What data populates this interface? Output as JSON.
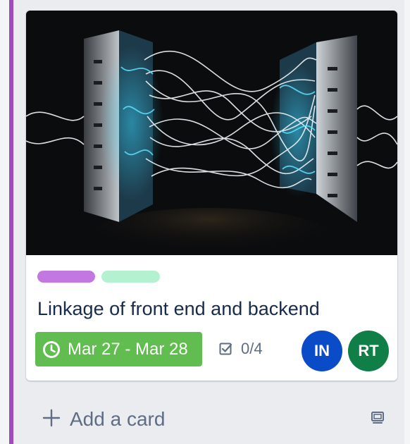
{
  "list": {
    "accent_color": "#a34ab9"
  },
  "card": {
    "cover": {
      "description_icon": "light-trails-cover-image"
    },
    "labels": [
      {
        "color": "#c377e0"
      },
      {
        "color": "#b3f1d0"
      }
    ],
    "title": "Linkage of front end and backend",
    "due": {
      "icon": "clock-icon",
      "text": "Mar 27 - Mar 28",
      "color": "#61bd4f"
    },
    "checklist": {
      "icon": "checkbox-icon",
      "text": "0/4"
    },
    "members": [
      {
        "initials": "IN",
        "color": "#0a4bc8"
      },
      {
        "initials": "RT",
        "color": "#0f7e47"
      }
    ]
  },
  "footer": {
    "add_card_label": "Add a card",
    "plus_icon": "plus-icon",
    "template_icon": "card-template-icon"
  }
}
